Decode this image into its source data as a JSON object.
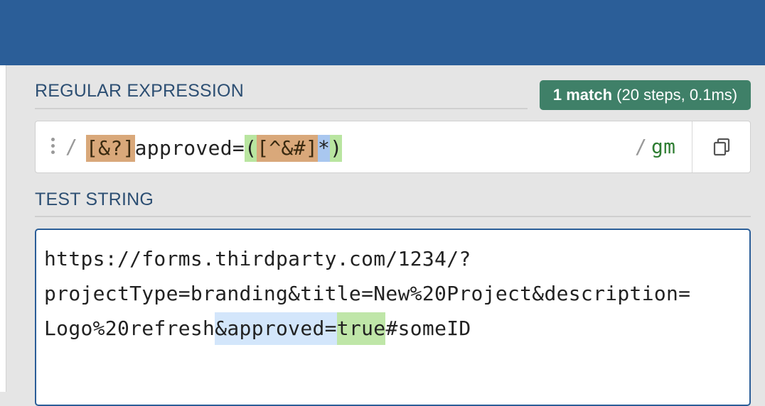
{
  "regex_section": {
    "title": "REGULAR EXPRESSION",
    "match_count": "1 match",
    "match_details": "(20 steps, 0.1ms)",
    "delimiter_open": "/",
    "pattern_parts": [
      "[&?]",
      "approved=",
      "(",
      "[^&#]",
      "*",
      ")"
    ],
    "delimiter_close": "/",
    "flags": "gm",
    "copy_icon": "copy-icon"
  },
  "test_section": {
    "title": "TEST STRING",
    "lines": [
      "https://forms.thirdparty.com/1234/?",
      "projectType=branding&title=New%20Project&description=",
      "Logo%20refresh"
    ],
    "match_prefix": "&approved=",
    "match_group": "true",
    "after_match": "#someID"
  },
  "colors": {
    "header": "#2b5e98",
    "badge": "#3f8068",
    "char_set": "#d9a87a",
    "group": "#b9e5a0",
    "quantifier": "#a9c7ef",
    "match_highlight": "#d3e6fb",
    "flags": "#2e7d32"
  }
}
